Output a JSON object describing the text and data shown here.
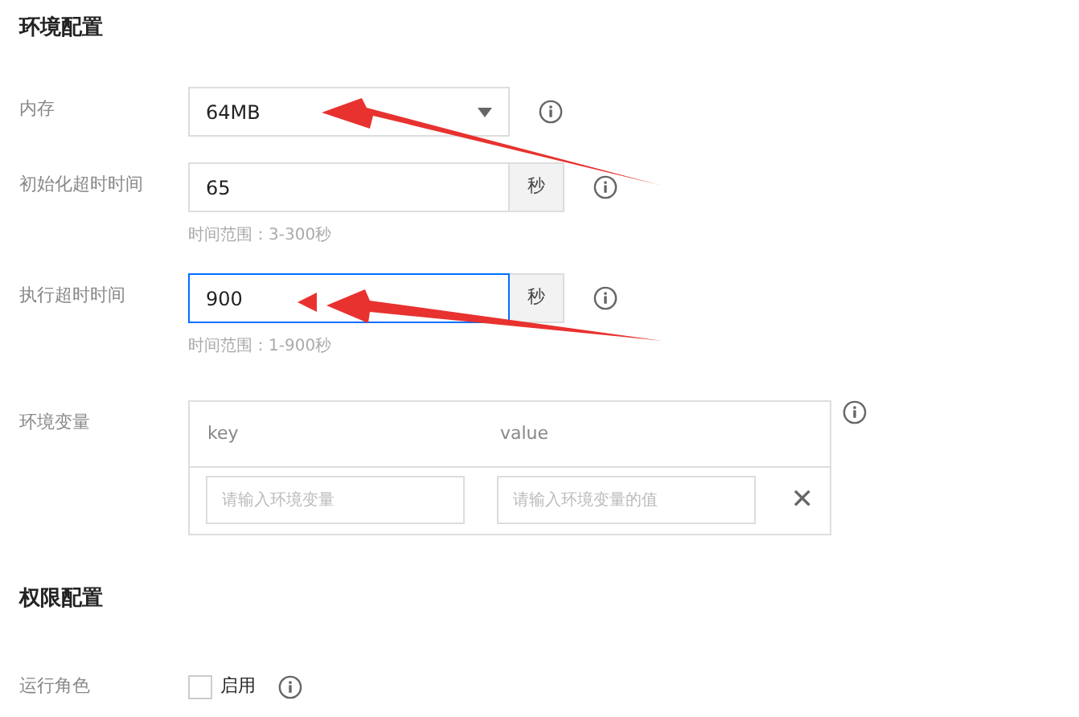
{
  "sections": [
    {
      "title": "环境配置",
      "fields": [
        {
          "kind": "select",
          "label": "内存",
          "value": "64MB",
          "focused": false
        },
        {
          "kind": "number",
          "label": "初始化超时时间",
          "value": "65",
          "unit": "秒",
          "hint": "时间范围：3-300秒",
          "focused": false
        },
        {
          "kind": "number",
          "label": "执行超时时间",
          "value": "900",
          "unit": "秒",
          "hint": "时间范围：1-900秒",
          "focused": true
        },
        {
          "kind": "envtable",
          "label": "环境变量",
          "columns": [
            "key",
            "value"
          ],
          "rows": [
            {
              "key_placeholder": "请输入环境变量",
              "value_placeholder": "请输入环境变量的值",
              "remove": "✕"
            }
          ]
        }
      ]
    },
    {
      "title": "权限配置",
      "fields": [
        {
          "kind": "checkbox",
          "label": "运行角色",
          "text": "启用",
          "checked": false
        }
      ]
    }
  ]
}
